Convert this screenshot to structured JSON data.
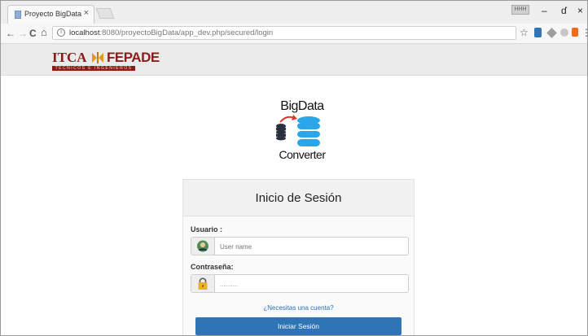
{
  "browser": {
    "tab_title": "Proyecto BigData",
    "tab_close": "×",
    "url_host": "localhost",
    "url_rest": ":8080/proyectoBigData/app_dev.php/secured/login",
    "user_badge": "HHH",
    "win_minimize": "–",
    "win_maximize": "ɗ",
    "win_close": "×",
    "nav_back": "←",
    "nav_forward": "→",
    "nav_reload": "C",
    "nav_home": "⌂",
    "bookmark_star": "☆",
    "menu": "⋮"
  },
  "header": {
    "logo_itca": "ITCA",
    "logo_fepade": "FEPADE",
    "logo_tagline": "TÉCNICOS E INGENIEROS"
  },
  "app_logo": {
    "title": "BigData",
    "subtitle": "Converter",
    "accent": "#2ba6e8"
  },
  "login": {
    "heading": "Inicio de Sesión",
    "username_label": "Usuario :",
    "username_placeholder": "User name",
    "password_label": "Contraseña:",
    "password_value": "..........",
    "account_link": "¿Necesitas una cuenta?",
    "submit_label": "Iniciar Sesión"
  },
  "colors": {
    "brand_red": "#8b1d17",
    "button_blue": "#2f75b5",
    "link_blue": "#2c6fb5"
  }
}
